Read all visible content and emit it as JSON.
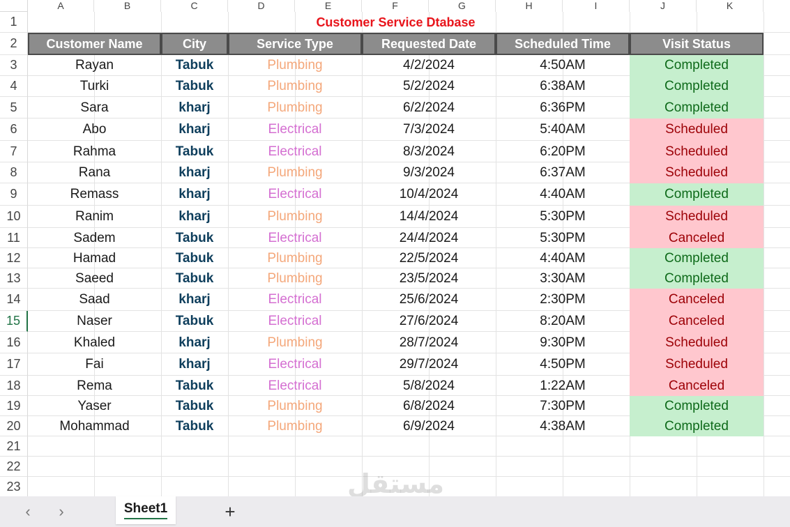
{
  "columns": [
    "A",
    "B",
    "C",
    "D",
    "E",
    "F",
    "G",
    "H",
    "I",
    "J",
    "K"
  ],
  "row_numbers": [
    "1",
    "2",
    "3",
    "4",
    "5",
    "6",
    "7",
    "8",
    "9",
    "10",
    "11",
    "12",
    "13",
    "14",
    "15",
    "16",
    "17",
    "18",
    "19",
    "20",
    "21",
    "22",
    "23"
  ],
  "title": "Customer Service Dtabase",
  "headers": [
    "Customer Name",
    "City",
    "Service Type",
    "Requested Date",
    "Scheduled Time",
    "Visit Status"
  ],
  "records": [
    {
      "name": "Rayan",
      "city": "Tabuk",
      "service": "Plumbing",
      "date": "4/2/2024",
      "time": "4:50AM",
      "status": "Completed"
    },
    {
      "name": "Turki",
      "city": "Tabuk",
      "service": "Plumbing",
      "date": "5/2/2024",
      "time": "6:38AM",
      "status": "Completed"
    },
    {
      "name": "Sara",
      "city": "kharj",
      "service": "Plumbing",
      "date": "6/2/2024",
      "time": "6:36PM",
      "status": "Completed"
    },
    {
      "name": "Abo",
      "city": "kharj",
      "service": "Electrical",
      "date": "7/3/2024",
      "time": "5:40AM",
      "status": "Scheduled"
    },
    {
      "name": "Rahma",
      "city": "Tabuk",
      "service": "Electrical",
      "date": "8/3/2024",
      "time": "6:20PM",
      "status": "Scheduled"
    },
    {
      "name": "Rana",
      "city": "kharj",
      "service": "Plumbing",
      "date": "9/3/2024",
      "time": "6:37AM",
      "status": "Scheduled"
    },
    {
      "name": "Remass",
      "city": "kharj",
      "service": "Electrical",
      "date": "10/4/2024",
      "time": "4:40AM",
      "status": "Completed"
    },
    {
      "name": "Ranim",
      "city": "kharj",
      "service": "Plumbing",
      "date": "14/4/2024",
      "time": "5:30PM",
      "status": "Scheduled"
    },
    {
      "name": "Sadem",
      "city": "Tabuk",
      "service": "Electrical",
      "date": "24/4/2024",
      "time": "5:30PM",
      "status": "Canceled"
    },
    {
      "name": "Hamad",
      "city": "Tabuk",
      "service": "Plumbing",
      "date": "22/5/2024",
      "time": "4:40AM",
      "status": "Completed"
    },
    {
      "name": "Saeed",
      "city": "Tabuk",
      "service": "Plumbing",
      "date": "23/5/2024",
      "time": "3:30AM",
      "status": "Completed"
    },
    {
      "name": "Saad",
      "city": "kharj",
      "service": "Electrical",
      "date": "25/6/2024",
      "time": "2:30PM",
      "status": "Canceled"
    },
    {
      "name": "Naser",
      "city": "Tabuk",
      "service": "Electrical",
      "date": "27/6/2024",
      "time": "8:20AM",
      "status": "Canceled"
    },
    {
      "name": "Khaled",
      "city": "kharj",
      "service": "Plumbing",
      "date": "28/7/2024",
      "time": "9:30PM",
      "status": "Scheduled"
    },
    {
      "name": "Fai",
      "city": "kharj",
      "service": "Electrical",
      "date": "29/7/2024",
      "time": "4:50PM",
      "status": "Scheduled"
    },
    {
      "name": "Rema",
      "city": "Tabuk",
      "service": "Electrical",
      "date": "5/8/2024",
      "time": "1:22AM",
      "status": "Canceled"
    },
    {
      "name": "Yaser",
      "city": "Tabuk",
      "service": "Plumbing",
      "date": "6/8/2024",
      "time": "7:30PM",
      "status": "Completed"
    },
    {
      "name": "Mohammad",
      "city": "Tabuk",
      "service": "Plumbing",
      "date": "6/9/2024",
      "time": "4:38AM",
      "status": "Completed"
    }
  ],
  "selected_row": "15",
  "tabs": {
    "sheet_name": "Sheet1",
    "prev_icon": "chevron-left-icon",
    "next_icon": "chevron-right-icon",
    "add_icon": "plus-icon"
  },
  "watermark": {
    "logo": "مستقل",
    "url": "mostaql.com"
  },
  "colors": {
    "title": "#e8141b",
    "header_bg": "#8c8c8c",
    "completed_bg": "#c6efce",
    "completed_text": "#0e6a1a",
    "issue_bg": "#ffc7ce",
    "issue_text": "#9c0006",
    "plumbing": "#f4a77a",
    "electrical": "#d46fd1",
    "city": "#0e3e5c"
  }
}
